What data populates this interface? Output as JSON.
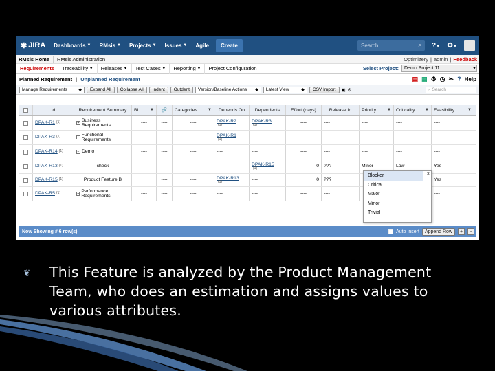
{
  "header": {
    "logo": "JIRA",
    "nav": [
      "Dashboards",
      "RMsis",
      "Projects",
      "Issues",
      "Agile"
    ],
    "create": "Create",
    "search_placeholder": "Search"
  },
  "rmsis_bar": {
    "home": "RMsis Home",
    "admin": "RMsis Administration",
    "right": [
      "Optimizery",
      "admin",
      "Feedback"
    ]
  },
  "menu": {
    "items": [
      "Requirements",
      "Traceability",
      "Releases",
      "Test Cases",
      "Reporting",
      "Project Configuration"
    ],
    "select_project_label": "Select Project:",
    "project": "Demo Project 11"
  },
  "title_bar": {
    "planned": "Planned Requirement",
    "sep": "|",
    "unplanned": "Unplanned Requirement",
    "help": "Help"
  },
  "toolbar": {
    "manage": "Manage Requirements",
    "expand": "Expand All",
    "collapse": "Collapse All",
    "indent": "Indent",
    "outdent": "Outdent",
    "version": "Version/Baseline Actions",
    "latest": "Latest View",
    "csv": "CSV Import",
    "search_placeholder": "Search"
  },
  "grid": {
    "columns": [
      "Id",
      "Requirement Summary",
      "BL",
      "",
      "Categories",
      "Depends On",
      "Dependents",
      "Effort (days)",
      "Release Id",
      "Priority",
      "Criticality",
      "Feasibility"
    ],
    "rows": [
      {
        "id": "DPAK-R1",
        "ver": "{1}",
        "exp": "+",
        "summary": "Business Requirements",
        "bl": "----",
        "link": "----",
        "cat": "----",
        "dep_on": "DPAK-R2",
        "dep_on_ver": "{1}",
        "dependents": "DPAK-R3",
        "dependents_ver": "{1}",
        "effort": "----",
        "release": "----",
        "priority": "----",
        "criticality": "----",
        "feasibility": "----"
      },
      {
        "id": "DPAK-R3",
        "ver": "{1}",
        "exp": "+",
        "summary": "Functional Requirements",
        "bl": "----",
        "link": "----",
        "cat": "----",
        "dep_on": "DPAK-R1",
        "dep_on_ver": "{1}",
        "dependents": "----",
        "dependents_ver": "",
        "effort": "----",
        "release": "----",
        "priority": "----",
        "criticality": "----",
        "feasibility": "----"
      },
      {
        "id": "DPAK-R14",
        "ver": "{1}",
        "exp": "−",
        "summary": "Demo",
        "bl": "----",
        "link": "----",
        "cat": "----",
        "dep_on": "----",
        "dep_on_ver": "",
        "dependents": "----",
        "dependents_ver": "",
        "effort": "----",
        "release": "----",
        "priority": "----",
        "criticality": "----",
        "feasibility": "----"
      },
      {
        "id": "DPAK-R13",
        "ver": "{1}",
        "exp": "",
        "summary": "check",
        "bl": "",
        "link": "----",
        "cat": "----",
        "dep_on": "----",
        "dep_on_ver": "",
        "dependents": "DPAK-R15",
        "dependents_ver": "{1}",
        "effort": "0",
        "release": "???",
        "priority": "Minor",
        "criticality": "Low",
        "feasibility": "Yes"
      },
      {
        "id": "DPAK-R15",
        "ver": "{1}",
        "exp": "",
        "summary": "Product Feature B",
        "bl": "",
        "link": "----",
        "cat": "----",
        "dep_on": "DPAK-R13",
        "dep_on_ver": "{1}",
        "dependents": "----",
        "dependents_ver": "",
        "effort": "0",
        "release": "???",
        "priority": "",
        "criticality": "",
        "feasibility": "Yes"
      },
      {
        "id": "DPAK-R5",
        "ver": "{1}",
        "exp": "+",
        "summary": "Performance Requirements",
        "bl": "----",
        "link": "----",
        "cat": "----",
        "dep_on": "----",
        "dep_on_ver": "",
        "dependents": "----",
        "dependents_ver": "",
        "effort": "----",
        "release": "----",
        "priority": "",
        "criticality": "",
        "feasibility": "----"
      }
    ]
  },
  "priority_dropdown": {
    "options": [
      "Blocker",
      "Critical",
      "Major",
      "Minor",
      "Trivial"
    ],
    "close": "×"
  },
  "footer": {
    "showing": "Now Showing # 6 row(s)",
    "auto_insert": "Auto Insert",
    "append_row": "Append Row",
    "plus": "+",
    "minus": "-"
  },
  "slide": {
    "text": "This Feature is analyzed by the Product Management Team, who does an estimation and assigns values to various attributes."
  },
  "colors": {
    "jira_blue": "#205081",
    "footer_blue": "#5b8cc8",
    "feedback_red": "#cc0000"
  }
}
